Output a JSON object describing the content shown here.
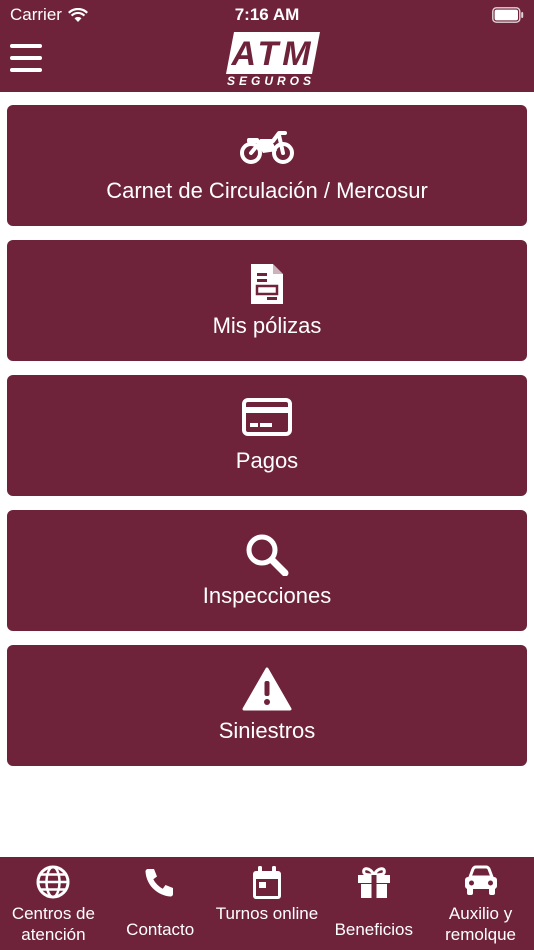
{
  "status_bar": {
    "carrier": "Carrier",
    "time": "7:16 AM"
  },
  "header": {
    "logo_text": "ATM",
    "logo_subtitle": "SEGUROS",
    "menu_icon": "hamburger-menu-icon"
  },
  "menu": [
    {
      "label": "Carnet de Circulación / Mercosur",
      "icon": "motorcycle-icon"
    },
    {
      "label": "Mis pólizas",
      "icon": "document-icon"
    },
    {
      "label": "Pagos",
      "icon": "credit-card-icon"
    },
    {
      "label": "Inspecciones",
      "icon": "magnifier-icon"
    },
    {
      "label": "Siniestros",
      "icon": "warning-icon"
    }
  ],
  "tabs": [
    {
      "label": "Centros de atención",
      "icon": "globe-icon"
    },
    {
      "label": "Contacto",
      "icon": "phone-icon"
    },
    {
      "label": "Turnos online",
      "icon": "calendar-icon"
    },
    {
      "label": "Beneficios",
      "icon": "gift-icon"
    },
    {
      "label": "Auxilio y remolque",
      "icon": "car-icon"
    }
  ],
  "colors": {
    "brand": "#6e233a",
    "background": "#ffffff",
    "text": "#ffffff"
  }
}
